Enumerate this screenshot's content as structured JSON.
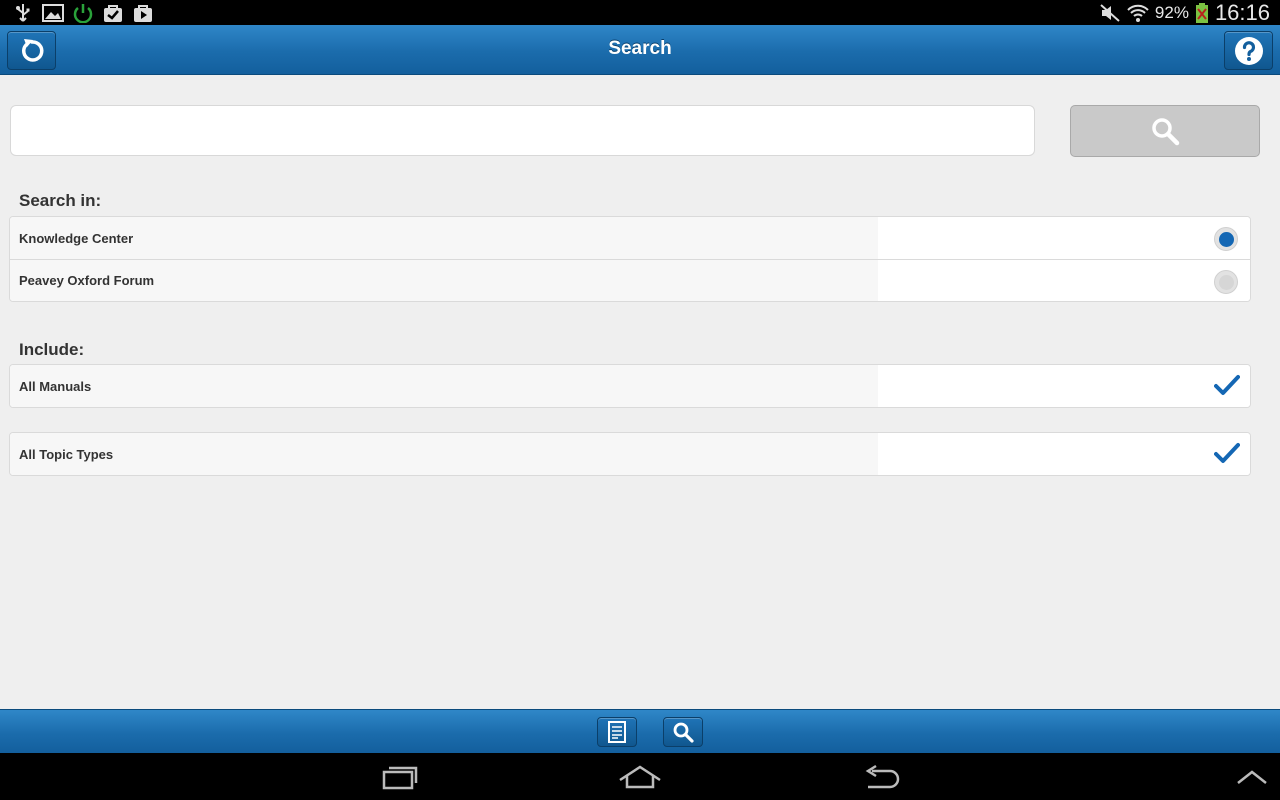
{
  "status_bar": {
    "battery_percent": "92%",
    "time": "16:16",
    "icons": [
      "usb-icon",
      "image-icon",
      "power-icon",
      "bag-check-icon",
      "play-store-icon",
      "mute-icon",
      "wifi-icon",
      "battery-icon"
    ]
  },
  "header": {
    "title": "Search",
    "left_button_icon": "refresh-icon",
    "right_button_icon": "help-icon"
  },
  "search": {
    "value": "",
    "placeholder": "",
    "button_icon": "search-icon"
  },
  "search_in": {
    "label": "Search in:",
    "options": [
      {
        "label": "Knowledge Center",
        "selected": true
      },
      {
        "label": "Peavey Oxford Forum",
        "selected": false
      }
    ]
  },
  "include": {
    "label": "Include:",
    "items": [
      {
        "label": "All Manuals",
        "checked": true
      },
      {
        "label": "All Topic Types",
        "checked": true
      }
    ]
  },
  "bottom_toolbar": {
    "buttons": [
      "document-icon",
      "search-icon"
    ]
  },
  "nav_bar": {
    "buttons": [
      "recent-apps-icon",
      "home-icon",
      "back-icon",
      "menu-up-icon"
    ]
  },
  "colors": {
    "accent": "#1b6cac",
    "selected_radio": "#1467b4",
    "checkmark": "#1467b4",
    "background": "#efefef"
  }
}
